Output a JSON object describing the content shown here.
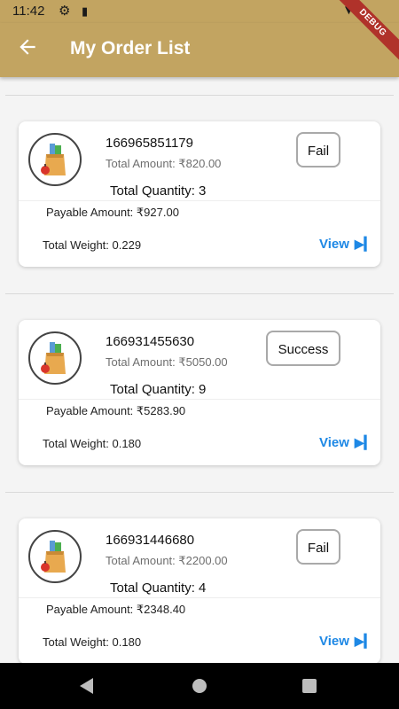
{
  "status_bar": {
    "time": "11:42"
  },
  "debug_banner": "DEBUG",
  "app_bar": {
    "title": "My Order List"
  },
  "orders": [
    {
      "order_id": "166965851179",
      "total_amount": "Total Amount: ₹820.00",
      "total_quantity": "Total Quantity: 3",
      "payable_amount": "Payable Amount:  ₹927.00",
      "total_weight": "Total Weight: 0.229",
      "status": "Fail",
      "view_label": "View"
    },
    {
      "order_id": "166931455630",
      "total_amount": "Total Amount: ₹5050.00",
      "total_quantity": "Total Quantity: 9",
      "payable_amount": "Payable Amount:  ₹5283.90",
      "total_weight": "Total Weight: 0.180",
      "status": "Success",
      "view_label": "View"
    },
    {
      "order_id": "166931446680",
      "total_amount": "Total Amount: ₹2200.00",
      "total_quantity": "Total Quantity: 4",
      "payable_amount": "Payable Amount:  ₹2348.40",
      "total_weight": "Total Weight: 0.180",
      "status": "Fail",
      "view_label": "View"
    }
  ],
  "colors": {
    "app_bar": "#c2a461",
    "link": "#1e88e5",
    "debug": "#b0322a"
  }
}
